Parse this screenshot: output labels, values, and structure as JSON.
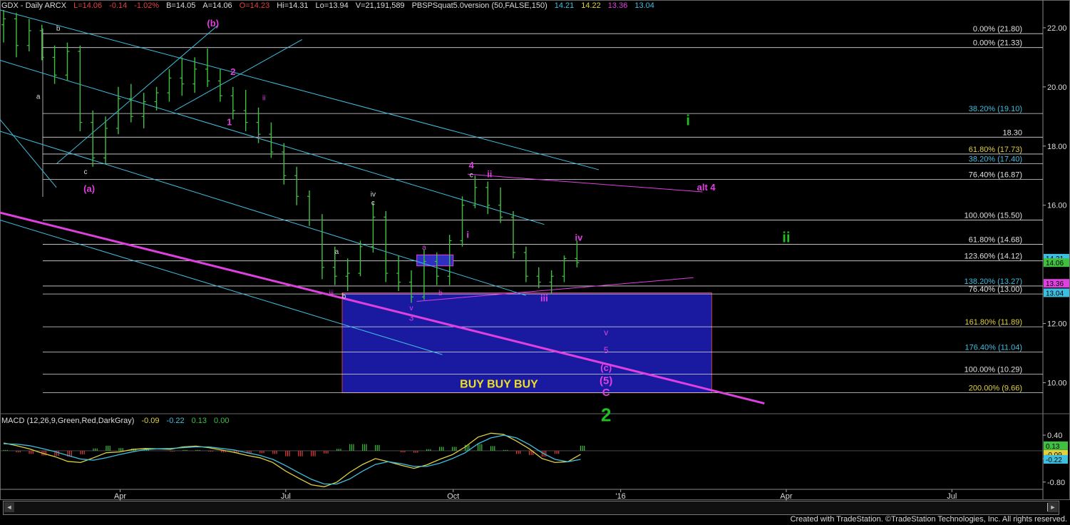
{
  "header": {
    "symbol": "GDX - Daily  ARCX",
    "last": "L=14.06",
    "change": "-0.14",
    "pct": "-1.02%",
    "bid": "B=14.05",
    "ask": "A=14.06",
    "open": "O=14.23",
    "high": "Hi=14.31",
    "low": "Lo=13.94",
    "volume": "V=21,191,589",
    "indicator": "PBSPSquat5.0version (50,FALSE,150)",
    "ind_values": [
      {
        "text": "14.21",
        "color": "#3fbfe0"
      },
      {
        "text": "14.22",
        "color": "#e0d040"
      },
      {
        "text": "13.36",
        "color": "#e040e0"
      },
      {
        "text": "13.04",
        "color": "#3fbfe0"
      }
    ]
  },
  "macd": {
    "label": "MACD (12,26,9,Green,Red,DarkGray)",
    "values": [
      {
        "text": "-0.09",
        "color": "#e0d040"
      },
      {
        "text": "-0.22",
        "color": "#3fbfe0"
      },
      {
        "text": "0.13",
        "color": "#40c040"
      },
      {
        "text": "0.00",
        "color": "#40c040"
      }
    ]
  },
  "footer": "Created with TradeStation. ©TradeStation Technologies, Inc. All rights reserved.",
  "scroll_left": "◄",
  "scroll_right": "►",
  "chart_data": {
    "type": "candlestick",
    "ylim": [
      9.0,
      22.6
    ],
    "xlim": [
      "2015-01-25",
      "2016-08-20"
    ],
    "x_ticks": [
      {
        "label": "Apr",
        "date": "2015-04-01"
      },
      {
        "label": "Jul",
        "date": "2015-07-01"
      },
      {
        "label": "Oct",
        "date": "2015-10-01"
      },
      {
        "label": "'16",
        "date": "2016-01-01"
      },
      {
        "label": "Apr",
        "date": "2016-04-01"
      },
      {
        "label": "Jul",
        "date": "2016-07-01"
      }
    ],
    "y_ticks": [
      22.0,
      20.0,
      18.0,
      16.0,
      12.0,
      10.0
    ],
    "fib_levels": [
      {
        "label": "0.00% (21.80)",
        "value": 21.8,
        "color": "#e0e0e0"
      },
      {
        "label": "0.00% (21.33)",
        "value": 21.33,
        "color": "#e0e0e0"
      },
      {
        "label": "38.20% (19.10)",
        "value": 19.1,
        "color": "#3fbfe0"
      },
      {
        "label": "18.30",
        "value": 18.3,
        "color": "#e0e0e0"
      },
      {
        "label": "61.80% (17.73)",
        "value": 17.73,
        "color": "#e0d040"
      },
      {
        "label": "38.20% (17.40)",
        "value": 17.4,
        "color": "#3fbfe0"
      },
      {
        "label": "76.40% (16.87)",
        "value": 16.87,
        "color": "#e0e0e0"
      },
      {
        "label": "100.00% (15.50)",
        "value": 15.5,
        "color": "#e0e0e0"
      },
      {
        "label": "61.80% (14.68)",
        "value": 14.68,
        "color": "#e0e0e0"
      },
      {
        "label": "123.60% (14.12)",
        "value": 14.12,
        "color": "#e0e0e0"
      },
      {
        "label": "138.20% (13.27)",
        "value": 13.27,
        "color": "#3fbfe0"
      },
      {
        "label": "76.40% (13.00)",
        "value": 13.0,
        "color": "#e0e0e0"
      },
      {
        "label": "161.80% (11.89)",
        "value": 11.89,
        "color": "#e0d040"
      },
      {
        "label": "176.40% (11.04)",
        "value": 11.04,
        "color": "#3fbfe0"
      },
      {
        "label": "100.00% (10.29)",
        "value": 10.29,
        "color": "#e0e0e0"
      },
      {
        "label": "200.00% (9.66)",
        "value": 9.66,
        "color": "#e0d040"
      }
    ],
    "price_badges": [
      {
        "text": "14.21",
        "value": 14.21,
        "bg": "#3fbfe0"
      },
      {
        "text": "14.06",
        "value": 14.06,
        "bg": "#40c040"
      },
      {
        "text": "13.36",
        "value": 13.36,
        "bg": "#e040e0"
      },
      {
        "text": "13.04",
        "value": 13.04,
        "bg": "#3fbfe0"
      }
    ],
    "buy_box": {
      "x0": "2015-08-01",
      "x1": "2016-02-20",
      "y0": 9.66,
      "y1": 13.04,
      "label": "BUY  BUY  BUY"
    },
    "trendlines": [
      {
        "color": "#e040e0",
        "width": 3,
        "points": [
          [
            "2015-01-25",
            15.75
          ],
          [
            "2016-03-20",
            9.3
          ]
        ]
      },
      {
        "color": "#3fbfe0",
        "width": 1,
        "points": [
          [
            "2015-01-25",
            22.6
          ],
          [
            "2015-12-20",
            17.2
          ]
        ]
      },
      {
        "color": "#3fbfe0",
        "width": 1,
        "points": [
          [
            "2015-01-25",
            20.9
          ],
          [
            "2015-11-20",
            15.35
          ]
        ]
      },
      {
        "color": "#3fbfe0",
        "width": 1,
        "points": [
          [
            "2015-01-25",
            18.5
          ],
          [
            "2015-11-10",
            12.95
          ]
        ]
      },
      {
        "color": "#3fbfe0",
        "width": 1,
        "points": [
          [
            "2015-01-25",
            15.5
          ],
          [
            "2015-09-25",
            10.95
          ]
        ]
      },
      {
        "color": "#3fbfe0",
        "width": 1,
        "points": [
          [
            "2015-02-25",
            17.4
          ],
          [
            "2015-05-25",
            22.1
          ]
        ]
      },
      {
        "color": "#3fbfe0",
        "width": 1,
        "points": [
          [
            "2015-05-01",
            19.2
          ],
          [
            "2015-07-10",
            21.6
          ]
        ]
      },
      {
        "color": "#3fbfe0",
        "width": 1,
        "points": [
          [
            "2015-01-25",
            18.9
          ],
          [
            "2015-02-25",
            16.6
          ]
        ]
      },
      {
        "color": "#e040e0",
        "width": 1,
        "points": [
          [
            "2015-10-09",
            17.05
          ],
          [
            "2016-02-15",
            16.45
          ]
        ]
      },
      {
        "color": "#e040e0",
        "width": 1,
        "points": [
          [
            "2015-09-11",
            12.75
          ],
          [
            "2016-02-10",
            13.55
          ]
        ]
      }
    ],
    "ohlc": [
      {
        "d": "2015-01-27",
        "o": 22.1,
        "h": 22.6,
        "l": 21.5,
        "c": 22.3
      },
      {
        "d": "2015-02-03",
        "o": 22.3,
        "h": 22.5,
        "l": 21.0,
        "c": 21.4
      },
      {
        "d": "2015-02-10",
        "o": 21.4,
        "h": 22.3,
        "l": 21.2,
        "c": 21.9
      },
      {
        "d": "2015-02-17",
        "o": 21.9,
        "h": 22.1,
        "l": 20.9,
        "c": 21.0
      },
      {
        "d": "2015-02-24",
        "o": 21.0,
        "h": 21.4,
        "l": 20.1,
        "c": 20.4
      },
      {
        "d": "2015-03-03",
        "o": 20.4,
        "h": 21.5,
        "l": 20.2,
        "c": 21.2
      },
      {
        "d": "2015-03-10",
        "o": 21.2,
        "h": 21.4,
        "l": 18.5,
        "c": 18.8
      },
      {
        "d": "2015-03-17",
        "o": 18.8,
        "h": 19.2,
        "l": 17.3,
        "c": 17.6
      },
      {
        "d": "2015-03-24",
        "o": 17.6,
        "h": 19.0,
        "l": 17.4,
        "c": 18.6
      },
      {
        "d": "2015-03-31",
        "o": 18.6,
        "h": 20.0,
        "l": 18.4,
        "c": 19.6
      },
      {
        "d": "2015-04-07",
        "o": 19.6,
        "h": 20.1,
        "l": 18.8,
        "c": 19.0
      },
      {
        "d": "2015-04-14",
        "o": 19.0,
        "h": 19.8,
        "l": 18.6,
        "c": 19.5
      },
      {
        "d": "2015-04-21",
        "o": 19.5,
        "h": 20.0,
        "l": 19.2,
        "c": 19.8
      },
      {
        "d": "2015-04-28",
        "o": 19.8,
        "h": 20.6,
        "l": 19.5,
        "c": 20.3
      },
      {
        "d": "2015-05-05",
        "o": 20.3,
        "h": 21.0,
        "l": 19.7,
        "c": 20.1
      },
      {
        "d": "2015-05-12",
        "o": 20.1,
        "h": 21.0,
        "l": 19.8,
        "c": 20.6
      },
      {
        "d": "2015-05-19",
        "o": 20.6,
        "h": 21.3,
        "l": 20.0,
        "c": 20.2
      },
      {
        "d": "2015-05-26",
        "o": 20.2,
        "h": 20.6,
        "l": 19.5,
        "c": 19.7
      },
      {
        "d": "2015-06-02",
        "o": 19.7,
        "h": 20.0,
        "l": 18.9,
        "c": 19.2
      },
      {
        "d": "2015-06-09",
        "o": 19.2,
        "h": 19.9,
        "l": 18.5,
        "c": 18.8
      },
      {
        "d": "2015-06-16",
        "o": 18.8,
        "h": 19.3,
        "l": 18.1,
        "c": 18.4
      },
      {
        "d": "2015-06-23",
        "o": 18.4,
        "h": 18.8,
        "l": 17.6,
        "c": 17.8
      },
      {
        "d": "2015-06-30",
        "o": 17.8,
        "h": 18.1,
        "l": 16.7,
        "c": 17.0
      },
      {
        "d": "2015-07-07",
        "o": 17.0,
        "h": 17.3,
        "l": 16.0,
        "c": 16.3
      },
      {
        "d": "2015-07-14",
        "o": 16.3,
        "h": 16.5,
        "l": 15.3,
        "c": 15.5
      },
      {
        "d": "2015-07-21",
        "o": 15.5,
        "h": 15.7,
        "l": 13.5,
        "c": 13.9
      },
      {
        "d": "2015-07-28",
        "o": 13.9,
        "h": 14.6,
        "l": 13.3,
        "c": 13.6
      },
      {
        "d": "2015-08-04",
        "o": 13.6,
        "h": 14.2,
        "l": 13.1,
        "c": 13.7
      },
      {
        "d": "2015-08-11",
        "o": 13.7,
        "h": 14.8,
        "l": 13.6,
        "c": 14.6
      },
      {
        "d": "2015-08-18",
        "o": 14.6,
        "h": 16.1,
        "l": 14.4,
        "c": 15.6
      },
      {
        "d": "2015-08-25",
        "o": 15.6,
        "h": 15.8,
        "l": 13.4,
        "c": 13.7
      },
      {
        "d": "2015-09-01",
        "o": 13.7,
        "h": 14.3,
        "l": 13.1,
        "c": 13.4
      },
      {
        "d": "2015-09-08",
        "o": 13.4,
        "h": 13.8,
        "l": 12.7,
        "c": 12.9
      },
      {
        "d": "2015-09-15",
        "o": 12.9,
        "h": 14.5,
        "l": 12.8,
        "c": 14.1
      },
      {
        "d": "2015-09-22",
        "o": 14.1,
        "h": 14.4,
        "l": 13.3,
        "c": 13.6
      },
      {
        "d": "2015-09-29",
        "o": 13.6,
        "h": 15.0,
        "l": 13.3,
        "c": 14.8
      },
      {
        "d": "2015-10-06",
        "o": 14.8,
        "h": 16.3,
        "l": 14.6,
        "c": 16.0
      },
      {
        "d": "2015-10-13",
        "o": 16.0,
        "h": 17.0,
        "l": 15.9,
        "c": 16.6
      },
      {
        "d": "2015-10-20",
        "o": 16.6,
        "h": 16.8,
        "l": 15.7,
        "c": 16.0
      },
      {
        "d": "2015-10-27",
        "o": 16.0,
        "h": 16.6,
        "l": 15.4,
        "c": 15.6
      },
      {
        "d": "2015-11-03",
        "o": 15.6,
        "h": 15.8,
        "l": 14.2,
        "c": 14.4
      },
      {
        "d": "2015-11-10",
        "o": 14.4,
        "h": 14.6,
        "l": 13.4,
        "c": 13.6
      },
      {
        "d": "2015-11-17",
        "o": 13.6,
        "h": 13.9,
        "l": 13.2,
        "c": 13.4
      },
      {
        "d": "2015-11-24",
        "o": 13.4,
        "h": 13.8,
        "l": 13.0,
        "c": 13.6
      },
      {
        "d": "2015-12-01",
        "o": 13.6,
        "h": 14.3,
        "l": 13.4,
        "c": 14.2
      },
      {
        "d": "2015-12-08",
        "o": 14.2,
        "h": 14.8,
        "l": 13.9,
        "c": 14.06
      }
    ],
    "annotations": [
      {
        "t": "b",
        "d": "2015-02-26",
        "v": 21.9,
        "color": "#dddddd",
        "size": 10
      },
      {
        "t": "a",
        "d": "2015-02-15",
        "v": 19.6,
        "color": "#dddddd",
        "size": 10
      },
      {
        "t": "c",
        "d": "2015-03-13",
        "v": 17.05,
        "color": "#dddddd",
        "size": 10
      },
      {
        "t": "(a)",
        "d": "2015-03-15",
        "v": 16.45,
        "color": "#e040e0",
        "size": 13,
        "bold": true
      },
      {
        "t": "(b)",
        "d": "2015-05-22",
        "v": 22.05,
        "color": "#e040e0",
        "size": 13,
        "bold": true
      },
      {
        "t": "2",
        "d": "2015-06-02",
        "v": 20.4,
        "color": "#e040e0",
        "size": 13,
        "bold": true
      },
      {
        "t": "1",
        "d": "2015-05-31",
        "v": 18.7,
        "color": "#e040e0",
        "size": 13,
        "bold": true
      },
      {
        "t": "ii",
        "d": "2015-06-19",
        "v": 19.55,
        "color": "#e040e0",
        "size": 10
      },
      {
        "t": "i",
        "d": "2015-06-16",
        "v": 18.25,
        "color": "#e040e0",
        "size": 10
      },
      {
        "t": "iv",
        "d": "2015-08-18",
        "v": 16.3,
        "color": "#dddddd",
        "size": 10
      },
      {
        "t": "c",
        "d": "2015-08-18",
        "v": 16.0,
        "color": "#dddddd",
        "size": 10
      },
      {
        "t": "a",
        "d": "2015-07-29",
        "v": 14.35,
        "color": "#dddddd",
        "size": 10
      },
      {
        "t": "iii",
        "d": "2015-07-26",
        "v": 12.95,
        "color": "#e040e0",
        "size": 10
      },
      {
        "t": "b",
        "d": "2015-08-02",
        "v": 12.85,
        "color": "#dddddd",
        "size": 10
      },
      {
        "t": "a",
        "d": "2015-09-15",
        "v": 14.5,
        "color": "#e040e0",
        "size": 10
      },
      {
        "t": "b",
        "d": "2015-09-24",
        "v": 12.95,
        "color": "#e040e0",
        "size": 10
      },
      {
        "t": "v",
        "d": "2015-09-08",
        "v": 12.45,
        "color": "#e040e0",
        "size": 10
      },
      {
        "t": "3",
        "d": "2015-09-08",
        "v": 12.1,
        "color": "#e040e0",
        "size": 12
      },
      {
        "t": "4",
        "d": "2015-10-11",
        "v": 17.25,
        "color": "#e040e0",
        "size": 13,
        "bold": true
      },
      {
        "t": "c",
        "d": "2015-10-11",
        "v": 16.95,
        "color": "#dddddd",
        "size": 10
      },
      {
        "t": "ii",
        "d": "2015-10-21",
        "v": 16.95,
        "color": "#e040e0",
        "size": 13,
        "bold": true
      },
      {
        "t": "i",
        "d": "2015-10-09",
        "v": 14.9,
        "color": "#e040e0",
        "size": 13,
        "bold": true
      },
      {
        "t": "iii",
        "d": "2015-11-20",
        "v": 12.75,
        "color": "#e040e0",
        "size": 13,
        "bold": true
      },
      {
        "t": "iv",
        "d": "2015-12-09",
        "v": 14.8,
        "color": "#e040e0",
        "size": 13,
        "bold": true
      },
      {
        "t": "v",
        "d": "2015-12-24",
        "v": 11.6,
        "color": "#e040e0",
        "size": 12
      },
      {
        "t": "5",
        "d": "2015-12-24",
        "v": 11.0,
        "color": "#e040e0",
        "size": 12
      },
      {
        "t": "(c)",
        "d": "2015-12-24",
        "v": 10.4,
        "color": "#e040e0",
        "size": 13,
        "bold": true
      },
      {
        "t": "(5)",
        "d": "2015-12-24",
        "v": 9.95,
        "color": "#e040e0",
        "size": 15,
        "bold": true
      },
      {
        "t": "C",
        "d": "2015-12-24",
        "v": 9.55,
        "color": "#e040e0",
        "size": 15,
        "bold": true
      },
      {
        "t": "2",
        "d": "2015-12-24",
        "v": 8.7,
        "color": "#20c020",
        "size": 26,
        "bold": true
      },
      {
        "t": "i",
        "d": "2016-02-07",
        "v": 18.7,
        "color": "#20c020",
        "size": 20,
        "bold": true
      },
      {
        "t": "ii",
        "d": "2016-04-01",
        "v": 14.75,
        "color": "#20c020",
        "size": 20,
        "bold": true
      },
      {
        "t": "alt 4",
        "d": "2016-02-17",
        "v": 16.5,
        "color": "#e040e0",
        "size": 13,
        "bold": true
      }
    ],
    "macd": {
      "ylim": [
        -0.95,
        0.62
      ],
      "y_ticks": [
        0.4,
        -0.2,
        -0.8
      ],
      "badges": [
        {
          "text": "0.13",
          "value": 0.13,
          "bg": "#40c040"
        },
        {
          "text": "-0.09",
          "value": -0.09,
          "bg": "#e0d040"
        },
        {
          "text": "-0.22",
          "value": -0.22,
          "bg": "#3fbfe0"
        }
      ],
      "macd_line": [
        [
          0.2,
          0.13,
          0.05,
          -0.06,
          -0.15,
          -0.27,
          -0.3,
          -0.18,
          -0.05,
          -0.03,
          0.03,
          0.06,
          0.05,
          0.04,
          0.1,
          0.12,
          0.08,
          0.02,
          -0.04,
          -0.12,
          -0.18,
          -0.3,
          -0.52,
          -0.7,
          -0.87,
          -0.92,
          -0.8,
          -0.55,
          -0.35,
          -0.2,
          -0.28,
          -0.37,
          -0.45,
          -0.36,
          -0.22,
          -0.1,
          0.1,
          0.35,
          0.45,
          0.42,
          0.25,
          0.05,
          -0.2,
          -0.3,
          -0.28,
          -0.09
        ]
      ],
      "signal_line": [
        [
          0.18,
          0.17,
          0.13,
          0.06,
          -0.02,
          -0.12,
          -0.21,
          -0.24,
          -0.18,
          -0.1,
          -0.03,
          0.03,
          0.05,
          0.06,
          0.08,
          0.1,
          0.1,
          0.06,
          0.02,
          -0.05,
          -0.12,
          -0.22,
          -0.38,
          -0.56,
          -0.73,
          -0.85,
          -0.85,
          -0.72,
          -0.52,
          -0.35,
          -0.28,
          -0.33,
          -0.4,
          -0.4,
          -0.32,
          -0.2,
          -0.05,
          0.18,
          0.33,
          0.4,
          0.33,
          0.16,
          -0.05,
          -0.22,
          -0.28,
          -0.22
        ]
      ]
    }
  }
}
